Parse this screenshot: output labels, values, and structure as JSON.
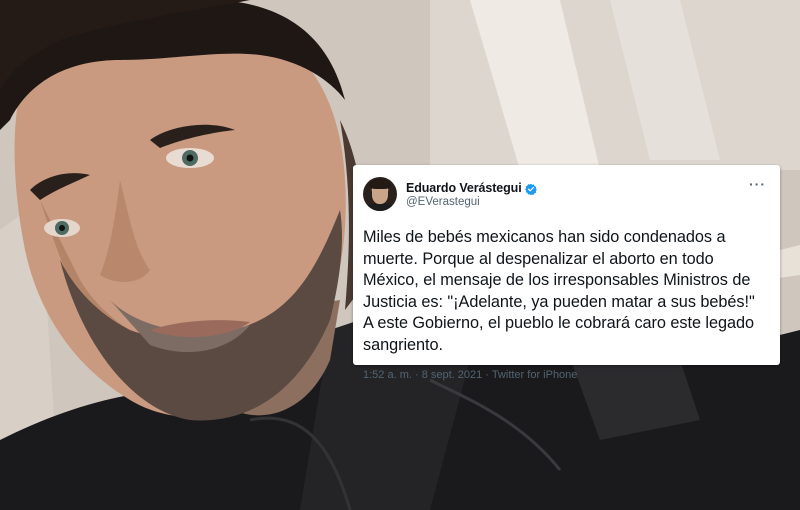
{
  "photo": {
    "description_icon": "man-selfie-photo"
  },
  "tweet": {
    "author_name": "Eduardo Verástegui",
    "author_handle": "@EVerastegui",
    "verified_icon": "verified-badge-icon",
    "more_icon": "more-options-icon",
    "more_label": "···",
    "text": "Miles de bebés mexicanos han sido condenados a\nmuerte. Porque al despenalizar el aborto en todo\nMéxico, el mensaje de los irresponsables Ministros de\nJusticia es: \"¡Adelante, ya pueden matar a sus bebés!\"\nA este Gobierno, el pueblo le cobrará caro este legado\nsangriento.",
    "meta": "1:52 a. m. · 8 sept. 2021 · Twitter for iPhone"
  },
  "colors": {
    "verified": "#1d9bf0",
    "text": "#0f1419",
    "secondary": "#536471"
  }
}
